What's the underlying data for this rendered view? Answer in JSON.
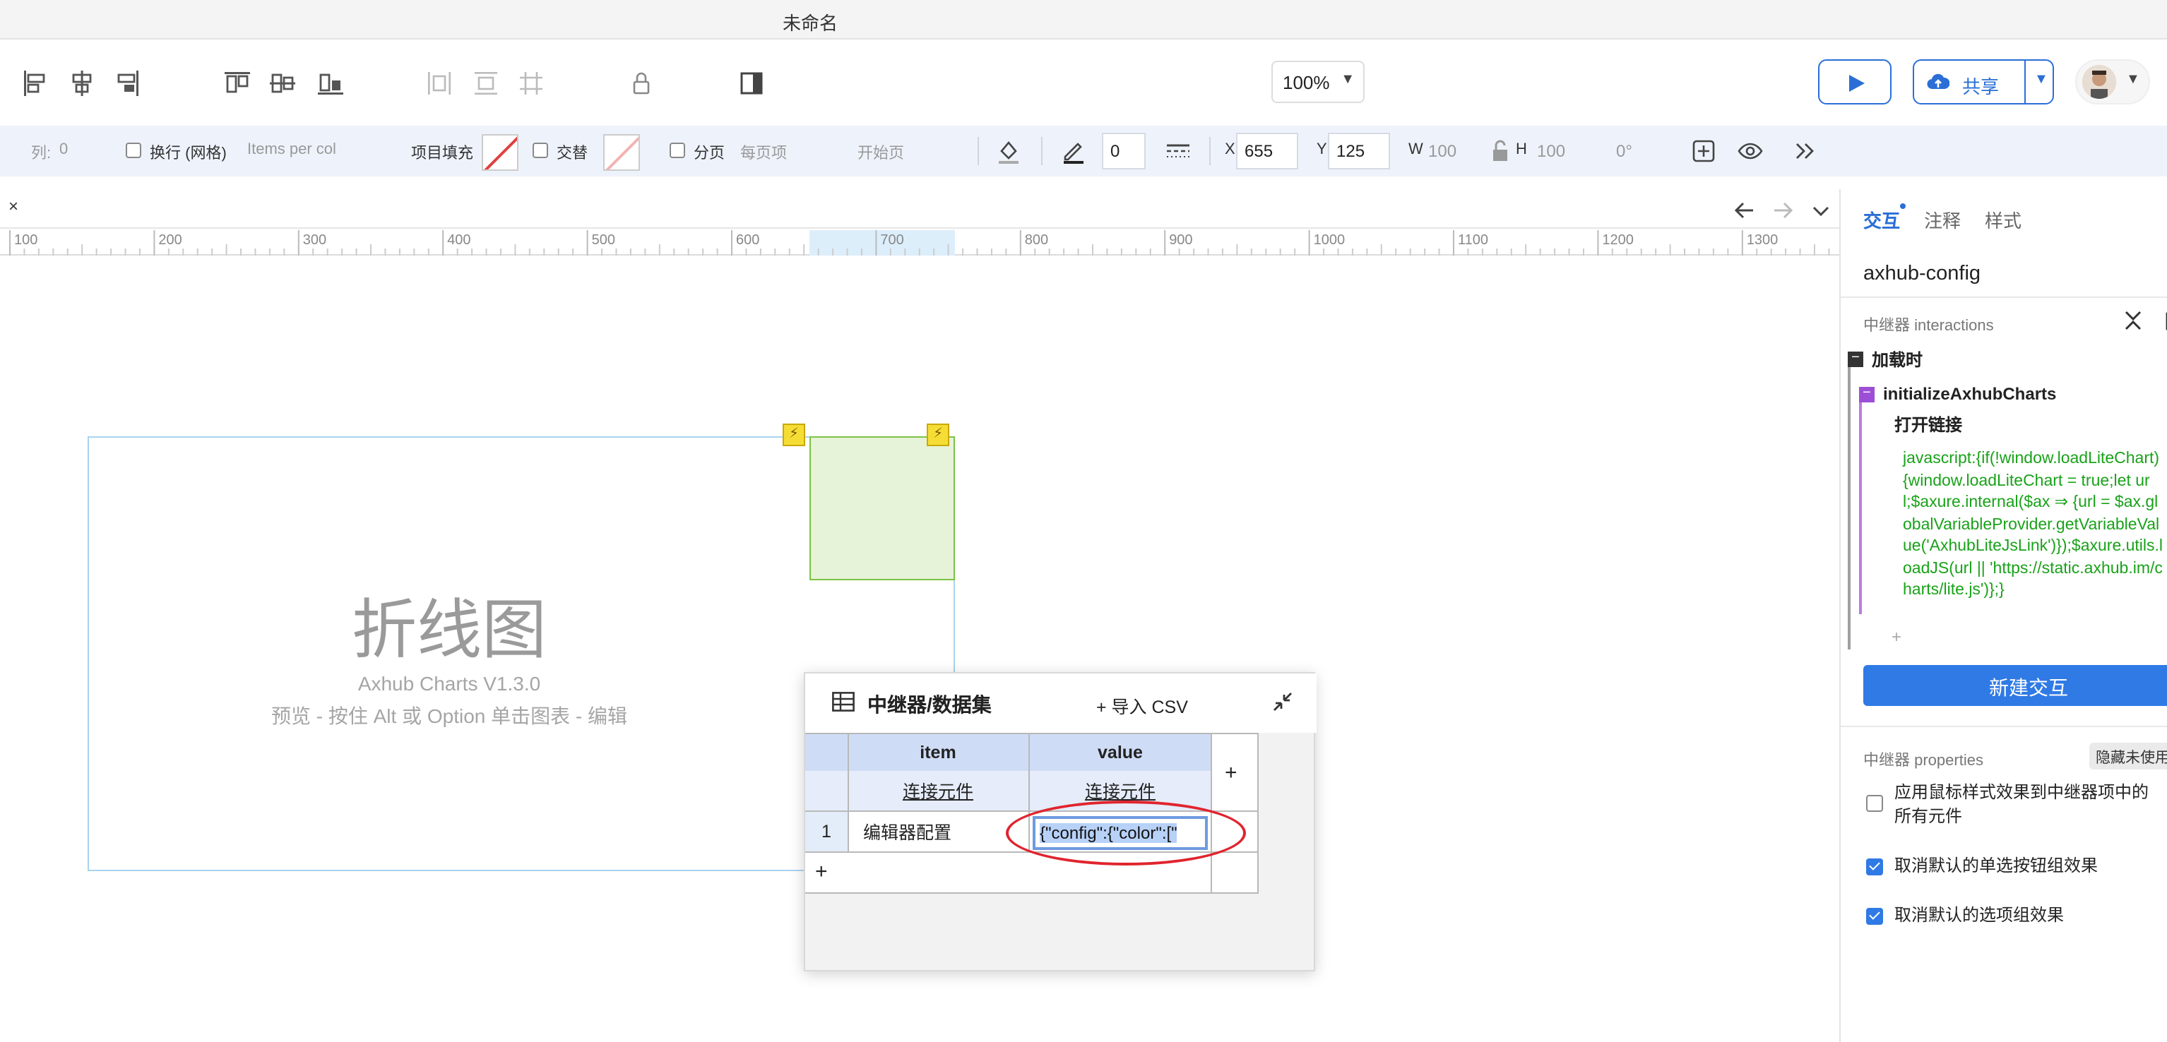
{
  "window": {
    "title": "未命名"
  },
  "toolbar": {
    "zoom": "100%",
    "share_label": "共享",
    "icons": [
      "align-left-icon",
      "align-center-icon",
      "align-right-icon",
      "align-top-icon",
      "align-middle-icon",
      "align-bottom-icon",
      "distribute-h-icon",
      "distribute-v-icon",
      "grid-icon",
      "lock-icon",
      "panel-toggle-icon"
    ]
  },
  "props": {
    "columns_label": "列:",
    "columns_value": "0",
    "wrap_label": "换行 (网格)",
    "items_per_col_placeholder": "Items per col",
    "fill_label": "项目填充",
    "alternate_label": "交替",
    "paging_label": "分页",
    "per_page_placeholder": "每页项",
    "start_page_placeholder": "开始页",
    "stroke_value": "0",
    "x_label": "X",
    "x_value": "655",
    "y_label": "Y",
    "y_value": "125",
    "w_label": "W",
    "w_value": "100",
    "h_label": "H",
    "h_value": "100",
    "rotation": "0°"
  },
  "canvas": {
    "tab_close": "×",
    "ruler_ticks": [
      "100",
      "200",
      "300",
      "400",
      "500",
      "600",
      "700",
      "800",
      "900",
      "1000",
      "1100",
      "1200",
      "1300"
    ],
    "chart_title": "折线图",
    "chart_version": "Axhub Charts V1.3.0",
    "chart_hint": "预览 - 按住 Alt 或 Option 单击图表 - 编辑",
    "bolt": "⚡"
  },
  "repeater_dialog": {
    "title": "中继器/数据集",
    "import_csv": "+ 导入 CSV",
    "columns": [
      {
        "name": "item",
        "link": "连接元件"
      },
      {
        "name": "value",
        "link": "连接元件"
      }
    ],
    "add_column": "+",
    "rows": [
      {
        "index": "1",
        "item": "编辑器配置",
        "value": "{\"config\":{\"color\":[\""
      }
    ],
    "add_row": "+"
  },
  "right_panel": {
    "tabs": [
      "交互",
      "注释",
      "样式"
    ],
    "active_tab": "交互",
    "element_name": "axhub-config",
    "interactions_header": "中继器 interactions",
    "event": "加载时",
    "case_name": "initializeAxhubCharts",
    "action": "打开链接",
    "code": "javascript:{if(!window.loadLiteChart){window.loadLiteChart = true;let url;$axure.internal($ax ⇒ {url = $ax.globalVariableProvider.getVariableValue('AxhubLiteJsLink')});$axure.utils.loadJS(url || 'https://static.axhub.im/charts/lite.js')};}",
    "add_action": "+",
    "new_interaction": "新建交互",
    "properties_header": "中继器 properties",
    "hide_unused": "隐藏未使用的",
    "options": [
      {
        "label": "应用鼠标样式效果到中继器项中的所有元件",
        "checked": false
      },
      {
        "label": "取消默认的单选按钮组效果",
        "checked": true
      },
      {
        "label": "取消默认的选项组效果",
        "checked": true
      }
    ]
  },
  "colors": {
    "accent": "#2f7ae5",
    "highlight_circle": "#e0242e",
    "code_green": "#19a219"
  }
}
